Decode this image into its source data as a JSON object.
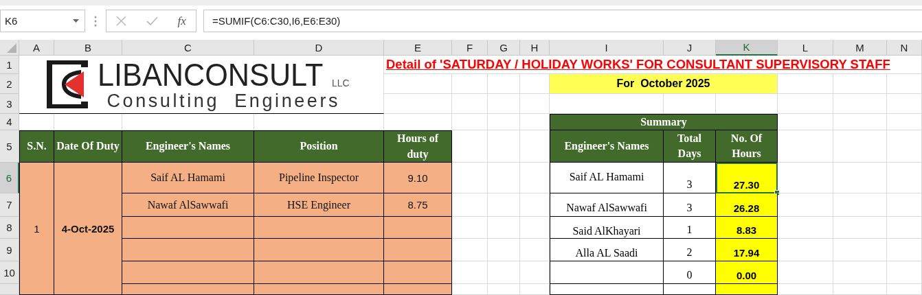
{
  "name_box": "K6",
  "formula_bar": {
    "function_label": "fx",
    "formula": "=SUMIF(C6:C30,I6,E6:E30)"
  },
  "columns": [
    {
      "label": "A",
      "selected": false
    },
    {
      "label": "B",
      "selected": false
    },
    {
      "label": "C",
      "selected": false
    },
    {
      "label": "D",
      "selected": false
    },
    {
      "label": "E",
      "selected": false
    },
    {
      "label": "F",
      "selected": false
    },
    {
      "label": "G",
      "selected": false
    },
    {
      "label": "H",
      "selected": false
    },
    {
      "label": "I",
      "selected": false
    },
    {
      "label": "J",
      "selected": false
    },
    {
      "label": "K",
      "selected": true
    },
    {
      "label": "L",
      "selected": false
    },
    {
      "label": "M",
      "selected": false
    },
    {
      "label": "N",
      "selected": false
    }
  ],
  "rows": [
    {
      "label": "1",
      "selected": false
    },
    {
      "label": "2",
      "selected": false
    },
    {
      "label": "3",
      "selected": false
    },
    {
      "label": "4",
      "selected": false
    },
    {
      "label": "5",
      "selected": false
    },
    {
      "label": "6",
      "selected": true
    },
    {
      "label": "7",
      "selected": false
    },
    {
      "label": "8",
      "selected": false
    },
    {
      "label": "9",
      "selected": false
    },
    {
      "label": "10",
      "selected": false
    }
  ],
  "logo": {
    "name": "LIBANCONSULT",
    "suffix": "LLC",
    "tagline": "Consulting  Engineers"
  },
  "title": "Detail of 'SATURDAY / HOLIDAY WORKS' FOR CONSULTANT SUPERVISORY STAFF",
  "period": "For  October 2025",
  "duty_table": {
    "columns": [
      "S.N.",
      "Date Of Duty",
      "Engineer's Names",
      "Position",
      "Hours of duty"
    ],
    "groups": [
      {
        "sn": "1",
        "date": "4-Oct-2025",
        "entries": [
          {
            "name": "Saif AL Hamami",
            "position": "Pipeline Inspector",
            "hours": "9.10"
          },
          {
            "name": "Nawaf AlSawwafi",
            "position": "HSE Engineer",
            "hours": "8.75"
          }
        ]
      }
    ]
  },
  "summary": {
    "title": "Summary",
    "columns": [
      "Engineer's Names",
      "Total Days",
      "No. Of Hours"
    ],
    "rows": [
      {
        "name": "Saif AL Hamami",
        "days": "3",
        "hours": "27.30",
        "selected": true
      },
      {
        "name": "Nawaf AlSawwafi",
        "days": "3",
        "hours": "26.28",
        "selected": false
      },
      {
        "name": "Said AlKhayari",
        "days": "1",
        "hours": "8.83",
        "selected": false
      },
      {
        "name": "Alla AL Saadi",
        "days": "2",
        "hours": "17.94",
        "selected": false
      },
      {
        "days": "0",
        "hours": "0.00",
        "selected": false
      },
      {
        "selected": false
      }
    ]
  }
}
